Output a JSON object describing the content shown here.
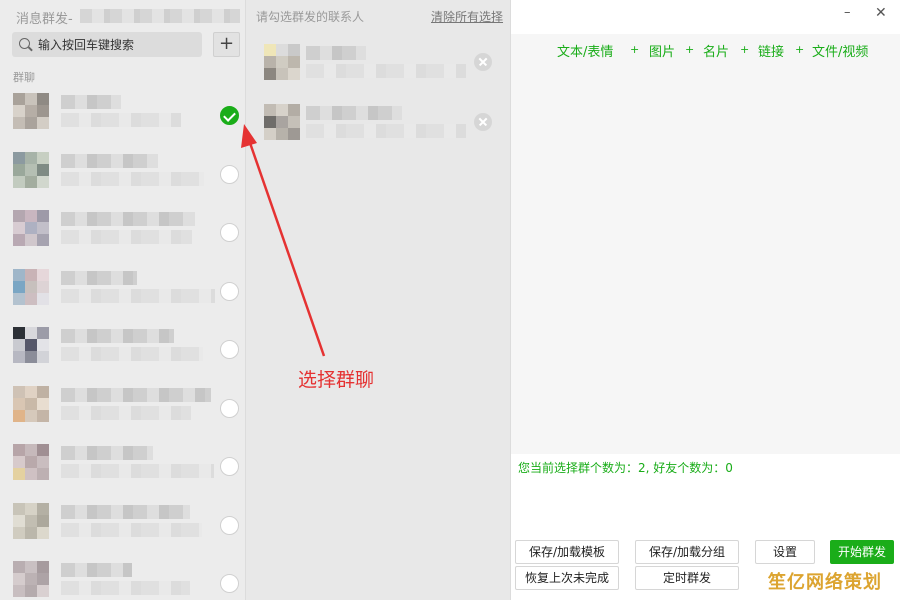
{
  "left_panel": {
    "title": "消息群发-",
    "search": {
      "placeholder": "输入按回车键搜索",
      "value": ""
    },
    "add_label": "+",
    "section_label": "群聊",
    "contacts": [
      {
        "checked": true
      },
      {
        "checked": false
      },
      {
        "checked": false
      },
      {
        "checked": false
      },
      {
        "checked": false
      },
      {
        "checked": false
      },
      {
        "checked": false
      },
      {
        "checked": false
      },
      {
        "checked": false
      }
    ]
  },
  "middle_panel": {
    "title": "请勾选群发的联系人",
    "clear_label": "清除所有选择",
    "selected_count": 2
  },
  "annotation": {
    "text": "选择群聊",
    "color": "#e53232"
  },
  "right_panel": {
    "window_controls": {
      "minimize": "–",
      "close": "✕"
    },
    "toolbar": {
      "items": [
        "文本/表情",
        "图片",
        "名片",
        "链接",
        "文件/视频"
      ],
      "separator": "+"
    },
    "status_line": "您当前选择群个数为：2, 好友个数为：0",
    "buttons": {
      "save_template": "保存/加载模板",
      "save_group": "保存/加载分组",
      "settings": "设置",
      "start": "开始群发",
      "restore": "恢复上次未完成",
      "schedule": "定时群发"
    }
  },
  "watermark": "笙亿网络策划",
  "colors": {
    "accent": "#1aad19",
    "annotation": "#e53232",
    "watermark": "#d99b1a"
  }
}
